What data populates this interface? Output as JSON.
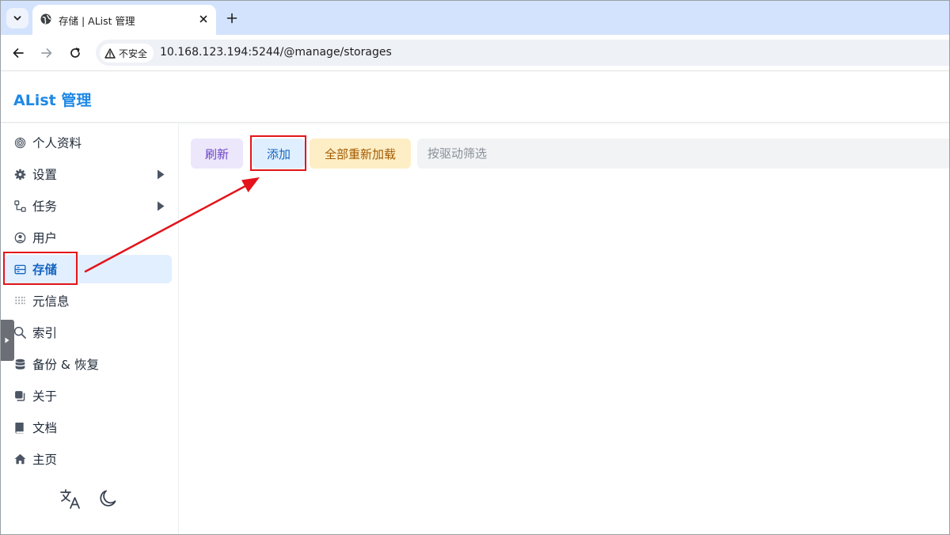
{
  "browser": {
    "tab_title": "存储 | AList 管理",
    "security_label": "不安全",
    "url": "10.168.123.194:5244/@manage/storages"
  },
  "app": {
    "title": "AList 管理"
  },
  "sidebar": {
    "items": [
      {
        "label": "个人资料",
        "icon": "fingerprint-icon",
        "has_arrow": false,
        "active": false
      },
      {
        "label": "设置",
        "icon": "gear-icon",
        "has_arrow": true,
        "active": false
      },
      {
        "label": "任务",
        "icon": "flow-icon",
        "has_arrow": true,
        "active": false
      },
      {
        "label": "用户",
        "icon": "user-circle-icon",
        "has_arrow": false,
        "active": false
      },
      {
        "label": "存储",
        "icon": "storage-icon",
        "has_arrow": false,
        "active": true
      },
      {
        "label": "元信息",
        "icon": "metadata-grid-icon",
        "has_arrow": false,
        "active": false
      },
      {
        "label": "索引",
        "icon": "search-icon",
        "has_arrow": false,
        "active": false
      },
      {
        "label": "备份 & 恢复",
        "icon": "database-icon",
        "has_arrow": false,
        "active": false
      },
      {
        "label": "关于",
        "icon": "copy-icon",
        "has_arrow": false,
        "active": false
      },
      {
        "label": "文档",
        "icon": "book-icon",
        "has_arrow": false,
        "active": false
      },
      {
        "label": "主页",
        "icon": "home-icon",
        "has_arrow": false,
        "active": false
      }
    ],
    "footer": {
      "language_icon": "translate-icon",
      "theme_icon": "moon-icon"
    }
  },
  "main": {
    "refresh_label": "刷新",
    "add_label": "添加",
    "reload_all_label": "全部重新加载",
    "filter_placeholder": "按驱动筛选"
  },
  "colors": {
    "brand": "#1e88e5",
    "active_bg": "#e2efff",
    "annotation": "#e3141b"
  }
}
